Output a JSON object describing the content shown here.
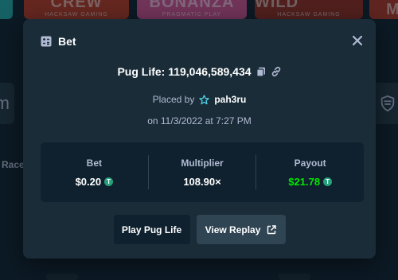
{
  "background": {
    "tiles": [
      {
        "title": "",
        "sub": ""
      },
      {
        "title": "CREW",
        "sub": "HACKSAW GAMING"
      },
      {
        "title": "BONANZA",
        "sub": "PRAGMATIC PLAY"
      },
      {
        "title": "DEAD or A WILD",
        "sub": "HACKSAW GAMING"
      },
      {
        "title": "M",
        "sub": ""
      }
    ],
    "left_card_glyph": "m",
    "left_text": "Race"
  },
  "modal": {
    "title": "Bet",
    "game_line": "Pug Life: 119,046,589,434",
    "placed_by_label": "Placed by",
    "username": "pah3ru",
    "date_line": "on 11/3/2022 at 7:27 PM",
    "stats": {
      "bet_label": "Bet",
      "bet_value": "$0.20",
      "multiplier_label": "Multiplier",
      "multiplier_value": "108.90×",
      "payout_label": "Payout",
      "payout_value": "$21.78"
    },
    "play_button": "Play Pug Life",
    "replay_button": "View Replay",
    "coin_symbol": "T"
  },
  "colors": {
    "bg": "#0f212e",
    "modal": "#1a2c38",
    "muted_text": "#b1bad3",
    "payout_green": "#00e701",
    "coin": "#26a17b"
  }
}
